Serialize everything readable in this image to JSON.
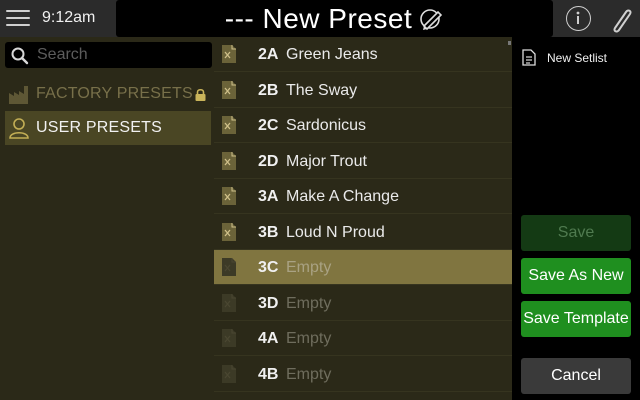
{
  "header": {
    "time": "9:12am",
    "preset_title": "--- New Preset",
    "icons": [
      "menu-icon",
      "edit-pencil-icon",
      "info-icon",
      "paperclip-icon"
    ]
  },
  "sidebar": {
    "search_placeholder": "Search",
    "categories": [
      {
        "label": "FACTORY PRESETS",
        "icon": "factory-icon",
        "locked": true,
        "selected": false
      },
      {
        "label": "USER PRESETS",
        "icon": "user-icon",
        "locked": false,
        "selected": true
      }
    ]
  },
  "presets": [
    {
      "num": "2A",
      "name": "Green Jeans",
      "empty": false
    },
    {
      "num": "2B",
      "name": "The Sway",
      "empty": false
    },
    {
      "num": "2C",
      "name": "Sardonicus",
      "empty": false
    },
    {
      "num": "2D",
      "name": "Major Trout",
      "empty": false
    },
    {
      "num": "3A",
      "name": "Make A Change",
      "empty": false
    },
    {
      "num": "3B",
      "name": "Loud N Proud",
      "empty": false
    },
    {
      "num": "3C",
      "name": "Empty",
      "empty": true,
      "selected": true
    },
    {
      "num": "3D",
      "name": "Empty",
      "empty": true
    },
    {
      "num": "4A",
      "name": "Empty",
      "empty": true
    },
    {
      "num": "4B",
      "name": "Empty",
      "empty": true
    }
  ],
  "actions": {
    "new_setlist": "New Setlist",
    "save": "Save",
    "save_as_new": "Save As New",
    "save_template": "Save Template",
    "cancel": "Cancel"
  },
  "colors": {
    "accent_green": "#1f8f1f",
    "selected_row": "#807540",
    "panel_bg": "#2b2918"
  }
}
